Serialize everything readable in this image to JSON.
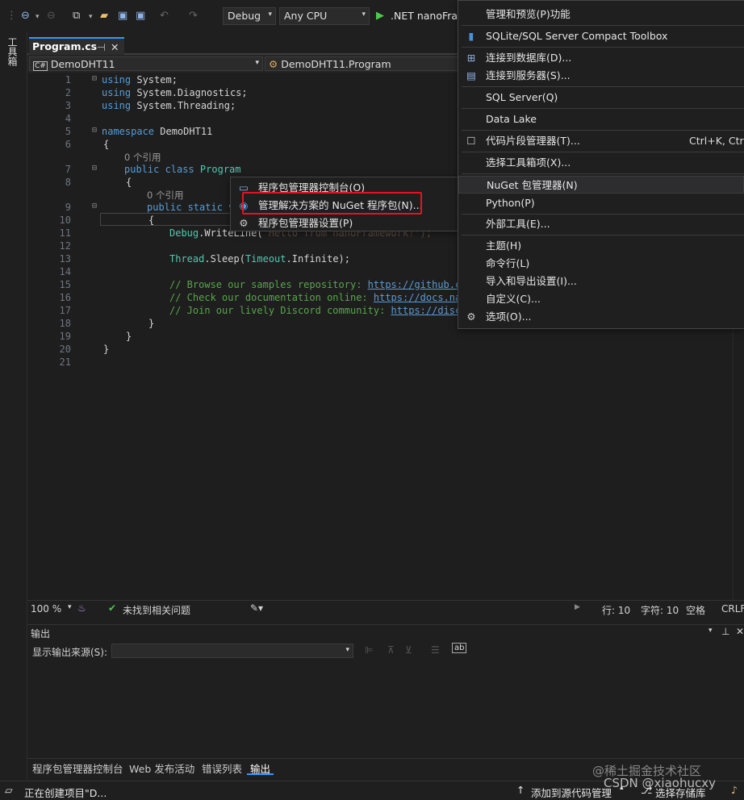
{
  "toolbar": {
    "config": "Debug",
    "platform": "Any CPU",
    "run_label": ".NET nanoFrar"
  },
  "sidebar": {
    "label": "工具箱"
  },
  "tab": {
    "label": "Program.cs",
    "pin": "⊣",
    "close": "✕"
  },
  "nav": {
    "project": "DemoDHT11",
    "class": "DemoDHT11.Program"
  },
  "code": {
    "lines": [
      "1",
      "2",
      "3",
      "4",
      "5",
      "6",
      "7",
      "8",
      "9",
      "10",
      "11",
      "12",
      "13",
      "14",
      "15",
      "16",
      "17",
      "18",
      "19",
      "20",
      "21"
    ],
    "using1": "using",
    "sys1": " System;",
    "using2": "using",
    "sys2": " System.Diagnostics;",
    "using3": "using",
    "sys3": " System.Threading;",
    "ns_kw": "namespace",
    "ns_name": " DemoDHT11",
    "brace_open": "{",
    "brace_close": "}",
    "ref0": "0 个引用",
    "class_kw": "public class",
    "class_name": " Program",
    "ref1": "0 个引用",
    "method_kw": "public static v",
    "debug_a": "Debug",
    "debug_b": ".WriteLine(",
    "debug_c": "\"Hello from nanoFramework!\");",
    "thread_a": "Thread",
    "thread_b": ".Sleep(",
    "thread_c": "Timeout",
    ".inf": "",
    "thread_d": ".Infinite);",
    "c1_text": "// Browse our samples repository: ",
    "c1_link": "https://github.co",
    "c2_text": "// Check our documentation online: ",
    "c2_link": "https://docs.nan",
    "c3_text": "// Join our lively Discord community: ",
    "c3_link": "https://disco"
  },
  "context_menu": {
    "items": [
      {
        "label": "程序包管理器控制台(O)",
        "icon": "console-icon"
      },
      {
        "label": "管理解决方案的 NuGet 程序包(N)...",
        "icon": "nuget-icon"
      },
      {
        "label": "程序包管理器设置(P)",
        "icon": "gear-icon"
      }
    ],
    "highlight_color": "#e81123"
  },
  "tools_menu": {
    "items": [
      {
        "label": "管理和预览(P)功能"
      },
      {
        "label": "SQLite/SQL Server Compact Toolbox"
      },
      {
        "label": "连接到数据库(D)..."
      },
      {
        "label": "连接到服务器(S)..."
      },
      {
        "label": "SQL Server(Q)"
      },
      {
        "label": "Data Lake"
      },
      {
        "label": "代码片段管理器(T)...",
        "shortcut": "Ctrl+K, Ctrl+"
      },
      {
        "label": "选择工具箱项(X)..."
      },
      {
        "label": "NuGet 包管理器(N)"
      },
      {
        "label": "Python(P)"
      },
      {
        "label": "外部工具(E)..."
      },
      {
        "label": "主题(H)"
      },
      {
        "label": "命令行(L)"
      },
      {
        "label": "导入和导出设置(I)..."
      },
      {
        "label": "自定义(C)..."
      },
      {
        "label": "选项(O)..."
      }
    ]
  },
  "editor_status": {
    "zoom": "100 %",
    "issues": "未找到相关问题",
    "line": "行: 10",
    "col": "字符: 10",
    "spacing": "空格",
    "eol": "CRLF"
  },
  "output": {
    "title": "输出",
    "source_label": "显示输出来源(S):",
    "source_value": ""
  },
  "bottom_tabs": [
    "程序包管理器控制台",
    "Web 发布活动",
    "错误列表",
    "输出"
  ],
  "statusbar": {
    "left": "正在创建项目\"D...",
    "add_source": "添加到源代码管理",
    "select_repo": "选择存储库"
  },
  "watermark": {
    "line1": "@稀土掘金技术社区",
    "line2": "CSDN @xiaohucxy"
  }
}
